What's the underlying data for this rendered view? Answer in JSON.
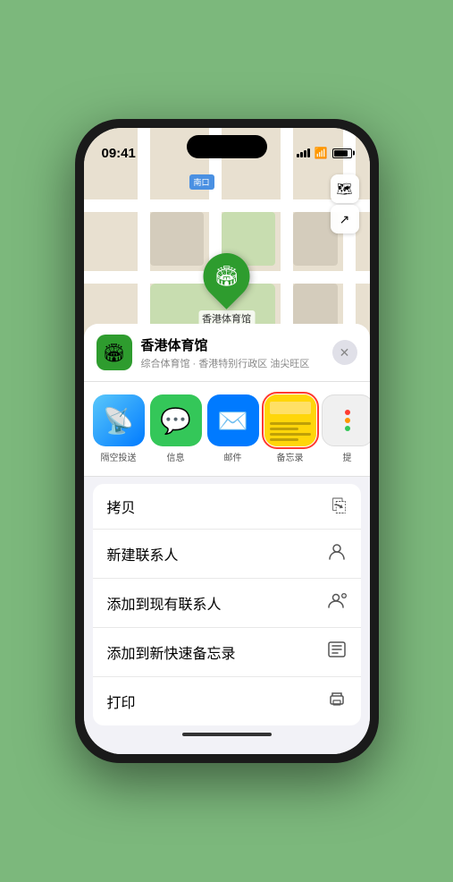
{
  "status": {
    "time": "09:41",
    "location_arrow": "➤"
  },
  "map": {
    "label": "南口",
    "controls": [
      "🗺",
      "⬆"
    ]
  },
  "marker": {
    "label": "香港体育馆",
    "icon": "🏟"
  },
  "location_card": {
    "icon": "🏟",
    "name": "香港体育馆",
    "subtitle": "综合体育馆 · 香港特别行政区 油尖旺区",
    "close": "✕"
  },
  "app_icons": [
    {
      "id": "airdrop",
      "label": "隔空投送",
      "selected": false
    },
    {
      "id": "message",
      "label": "信息",
      "selected": false
    },
    {
      "id": "mail",
      "label": "邮件",
      "selected": false
    },
    {
      "id": "notes",
      "label": "备忘录",
      "selected": true
    },
    {
      "id": "more",
      "label": "提",
      "selected": false
    }
  ],
  "actions": [
    {
      "label": "拷贝",
      "icon": "⎘"
    },
    {
      "label": "新建联系人",
      "icon": "👤"
    },
    {
      "label": "添加到现有联系人",
      "icon": "👤+"
    },
    {
      "label": "添加到新快速备忘录",
      "icon": "📋"
    },
    {
      "label": "打印",
      "icon": "🖨"
    }
  ]
}
